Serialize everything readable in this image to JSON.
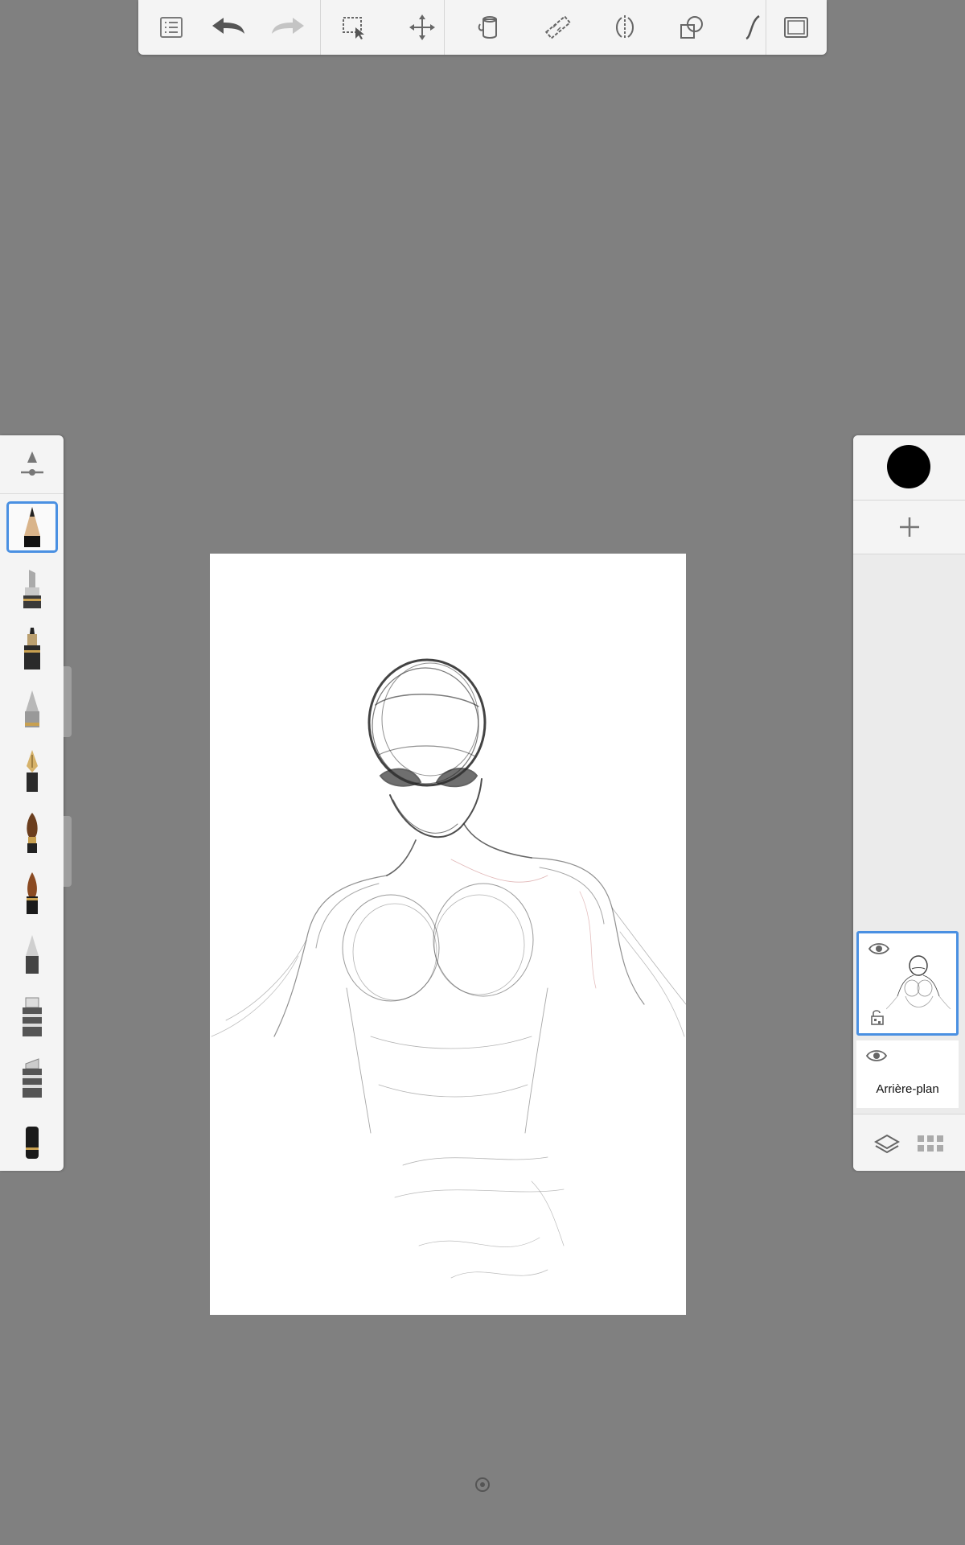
{
  "toolbar": {
    "items": [
      {
        "id": "menu",
        "icon": "list-menu-icon"
      },
      {
        "id": "undo",
        "icon": "undo-arrow-icon"
      },
      {
        "id": "redo",
        "icon": "redo-arrow-icon"
      },
      {
        "id": "selection",
        "icon": "selection-icon"
      },
      {
        "id": "transform",
        "icon": "move-arrows-icon"
      },
      {
        "id": "fill",
        "icon": "paint-bucket-icon"
      },
      {
        "id": "ruler",
        "icon": "ruler-icon"
      },
      {
        "id": "symmetry",
        "icon": "symmetry-icon"
      },
      {
        "id": "shapes",
        "icon": "shapes-icon"
      },
      {
        "id": "stroke",
        "icon": "predictive-stroke-icon"
      },
      {
        "id": "fullscreen",
        "icon": "fullscreen-icon"
      }
    ]
  },
  "brushes": {
    "selected_index": 0,
    "items": [
      "pencil",
      "marker",
      "felt-pen",
      "ballpoint",
      "fountain-pen",
      "paintbrush",
      "ink-brush",
      "airbrush",
      "chisel-marker",
      "wide-marker",
      "eraser"
    ]
  },
  "colors": {
    "current_color": "#000000",
    "accent": "#4a90e2",
    "workspace": "#808080"
  },
  "layers": {
    "items": [
      {
        "name": "",
        "visible": true,
        "active": true,
        "thumbnail": "spiderman-sketch"
      },
      {
        "name": "Arrière-plan",
        "visible": true,
        "active": false
      }
    ]
  },
  "canvas": {
    "content": "spiderman-sketch"
  }
}
